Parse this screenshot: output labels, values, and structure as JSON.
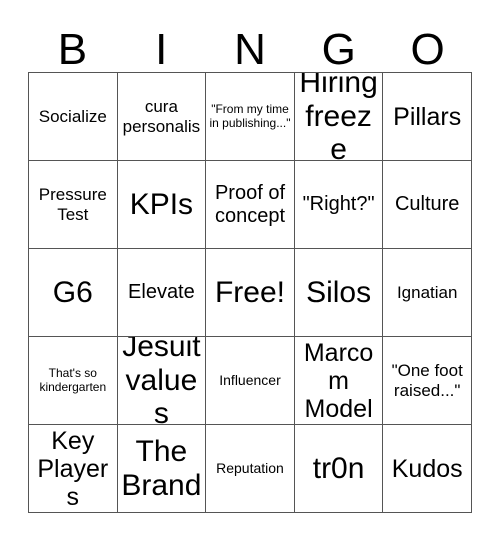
{
  "card": {
    "header_letters": [
      "B",
      "I",
      "N",
      "G",
      "O"
    ],
    "grid_size": 5,
    "free_space_label": "Free!",
    "free_space_position": {
      "row": 3,
      "column": 3
    },
    "colors": {
      "text": "#000000",
      "grid_line": "#555555",
      "background": "#ffffff"
    },
    "rows": [
      [
        {
          "text": "Socialize",
          "size": "md"
        },
        {
          "text": "cura personalis",
          "size": "md"
        },
        {
          "text": "\"From my time in publishing...\"",
          "size": "xs"
        },
        {
          "text": "Hiring freeze",
          "size": "xxl"
        },
        {
          "text": "Pillars",
          "size": "xl"
        }
      ],
      [
        {
          "text": "Pressure Test",
          "size": "md"
        },
        {
          "text": "KPIs",
          "size": "xxl"
        },
        {
          "text": "Proof of concept",
          "size": "lg"
        },
        {
          "text": "\"Right?\"",
          "size": "lg"
        },
        {
          "text": "Culture",
          "size": "lg"
        }
      ],
      [
        {
          "text": "G6",
          "size": "xxl"
        },
        {
          "text": "Elevate",
          "size": "lg"
        },
        {
          "text": "Free!",
          "size": "xxl"
        },
        {
          "text": "Silos",
          "size": "xxl"
        },
        {
          "text": "Ignatian",
          "size": "md"
        }
      ],
      [
        {
          "text": "That's so kindergarten",
          "size": "xs"
        },
        {
          "text": "Jesuit values",
          "size": "xxl"
        },
        {
          "text": "Influencer",
          "size": "sm"
        },
        {
          "text": "Marcom Model",
          "size": "xl"
        },
        {
          "text": "\"One foot raised...\"",
          "size": "md"
        }
      ],
      [
        {
          "text": "Key Players",
          "size": "xl"
        },
        {
          "text": "The Brand",
          "size": "xxl"
        },
        {
          "text": "Reputation",
          "size": "sm"
        },
        {
          "text": "tr0n",
          "size": "xxl"
        },
        {
          "text": "Kudos",
          "size": "xl"
        }
      ]
    ]
  }
}
